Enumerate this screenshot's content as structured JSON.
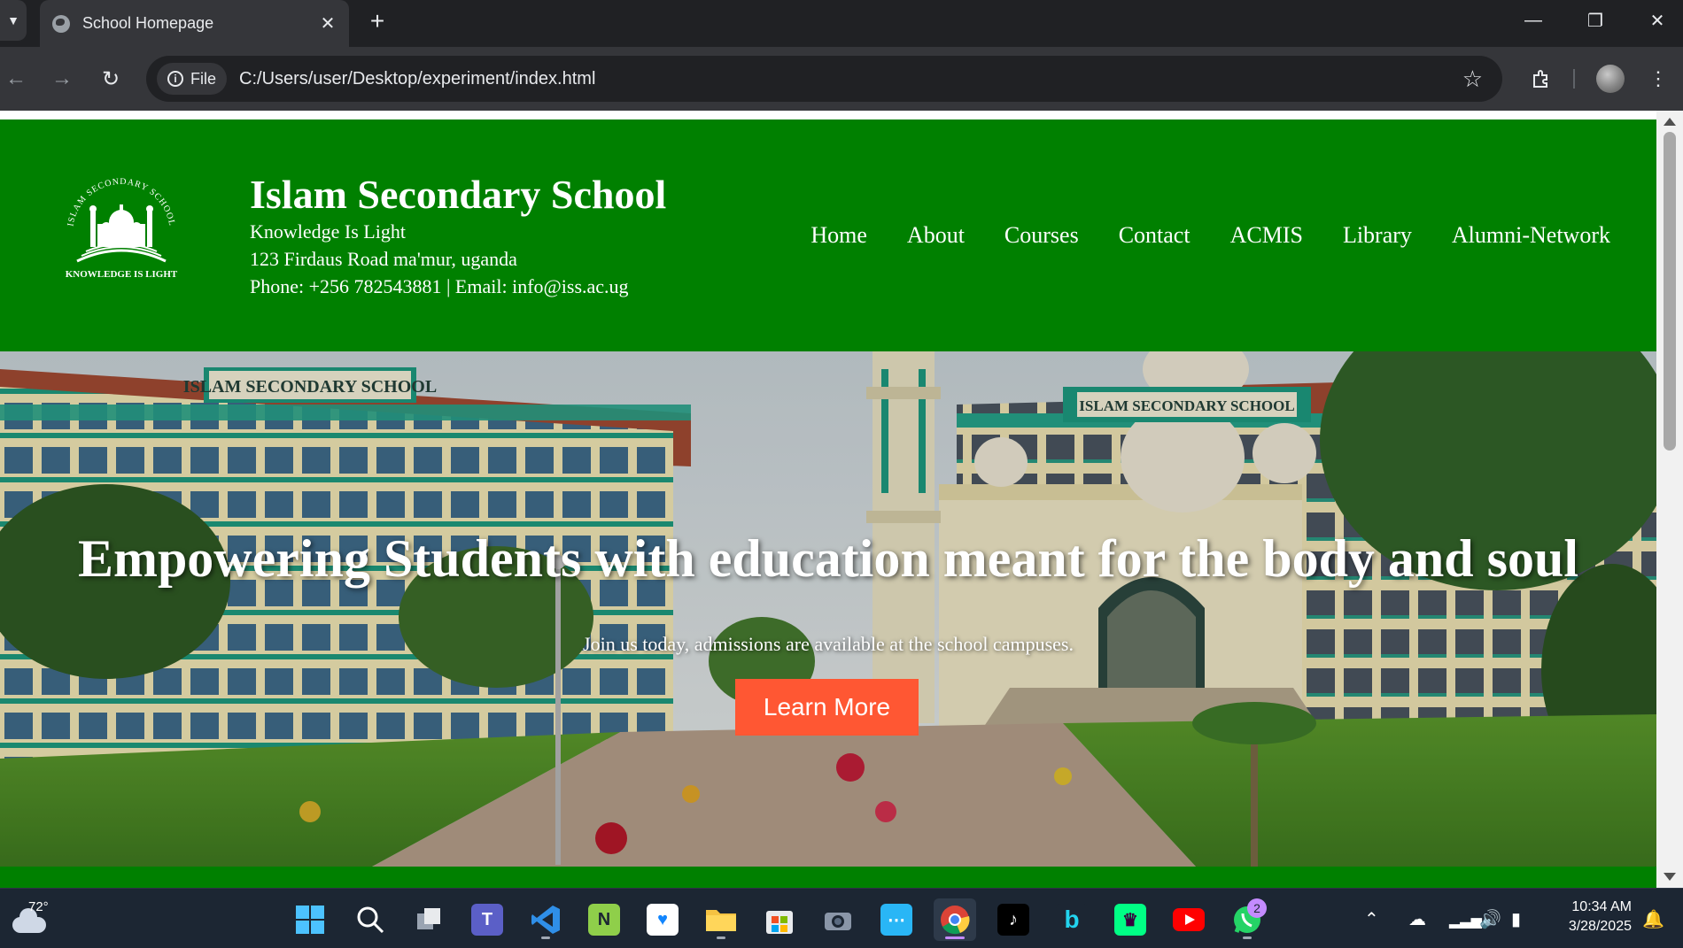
{
  "browser": {
    "tab_title": "School Homepage",
    "site_info_label": "File",
    "url": "C:/Users/user/Desktop/experiment/index.html"
  },
  "site": {
    "logo_text_top": "ISLAM SECONDARY SCHOOL",
    "logo_text_bottom": "KNOWLEDGE IS LIGHT",
    "name": "Islam Secondary School",
    "motto": "Knowledge Is Light",
    "address": "123 Firdaus Road ma'mur, uganda",
    "contact": "Phone: +256 782543881 | Email: info@iss.ac.ug",
    "nav": [
      "Home",
      "About",
      "Courses",
      "Contact",
      "ACMIS",
      "Library",
      "Alumni-Network"
    ]
  },
  "hero": {
    "headline": "Empowering Students with education meant for the body and soul",
    "subtext": "Join us today, admissions are available at the school campuses.",
    "button_label": "Learn More",
    "image_sign_left": "ISLAM SECONDARY SCHOOL",
    "image_sign_right": "ISLAM SECONDARY SCHOOL"
  },
  "colors": {
    "header_green": "#008000",
    "button_orange": "#FF5733"
  },
  "taskbar": {
    "weather_temp": "72°",
    "whatsapp_badge": "2",
    "time": "10:34 AM",
    "date": "3/28/2025",
    "apps": [
      "windows-start",
      "search",
      "task-view",
      "teams",
      "vscode",
      "notepad-plus-plus",
      "bluesky",
      "file-explorer",
      "microsoft-store",
      "camera",
      "feedback-hub",
      "chrome",
      "tiktok",
      "bing",
      "premier-league",
      "youtube",
      "whatsapp"
    ]
  }
}
